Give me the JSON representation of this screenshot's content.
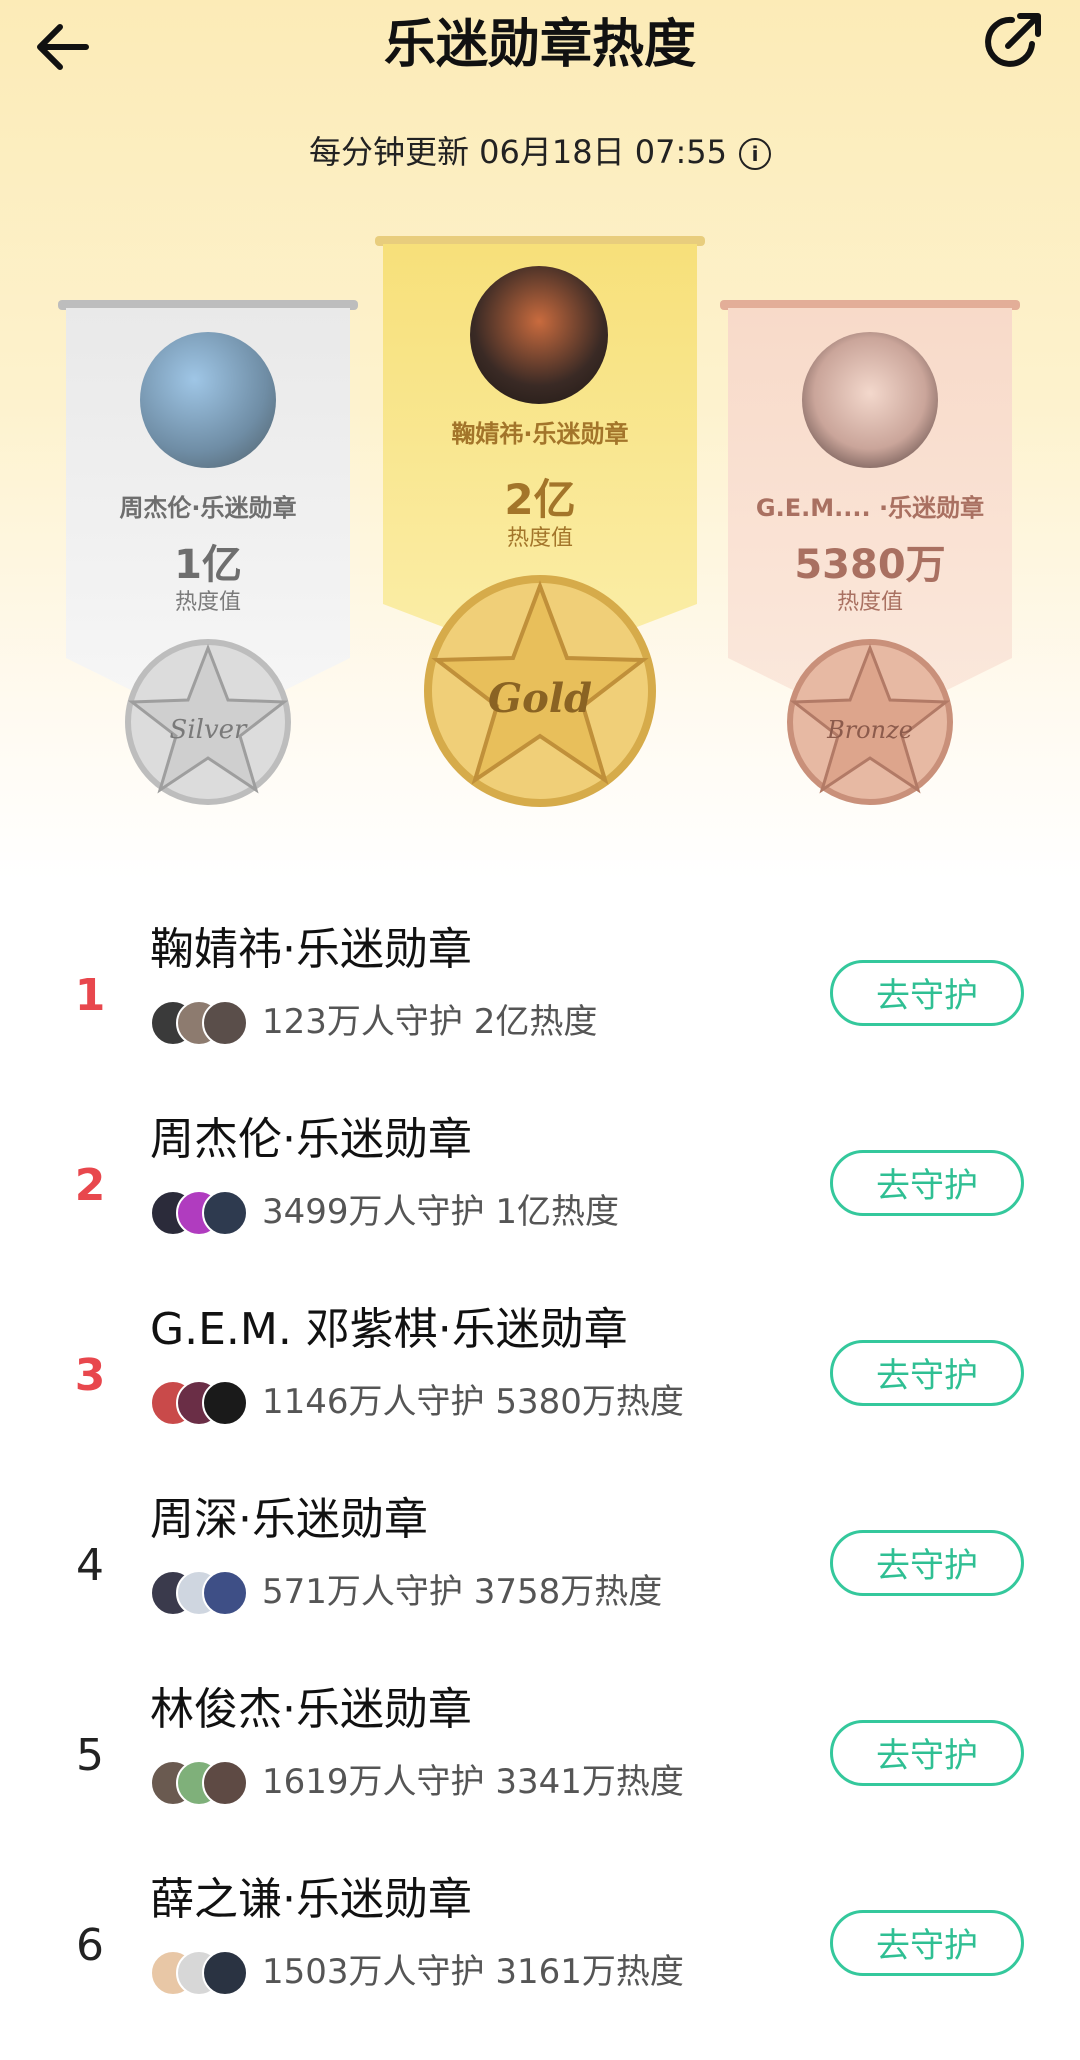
{
  "header": {
    "title": "乐迷勋章热度",
    "update_text": "每分钟更新 06月18日 07:55",
    "back_icon": "arrow-left-icon",
    "share_icon": "share-icon"
  },
  "podium": {
    "silver": {
      "name": "周杰伦·乐迷勋章",
      "value": "1亿",
      "unit": "热度值",
      "medal_text": "Silver",
      "color": "#c9c9c9"
    },
    "gold": {
      "name": "鞠婧祎·乐迷勋章",
      "value": "2亿",
      "unit": "热度值",
      "medal_text": "Gold",
      "color": "#f2cd63"
    },
    "bronze": {
      "name": "G.E.M.... ·乐迷勋章",
      "value": "5380万",
      "unit": "热度值",
      "medal_text": "Bronze",
      "color": "#e8b49b"
    }
  },
  "list": [
    {
      "rank": "1",
      "name": "鞠婧祎·乐迷勋章",
      "meta": "123万人守护 2亿热度",
      "button": "去守护"
    },
    {
      "rank": "2",
      "name": "周杰伦·乐迷勋章",
      "meta": "3499万人守护 1亿热度",
      "button": "去守护"
    },
    {
      "rank": "3",
      "name": "G.E.M. 邓紫棋·乐迷勋章",
      "meta": "1146万人守护 5380万热度",
      "button": "去守护"
    },
    {
      "rank": "4",
      "name": "周深·乐迷勋章",
      "meta": "571万人守护 3758万热度",
      "button": "去守护"
    },
    {
      "rank": "5",
      "name": "林俊杰·乐迷勋章",
      "meta": "1619万人守护 3341万热度",
      "button": "去守护"
    },
    {
      "rank": "6",
      "name": "薛之谦·乐迷勋章",
      "meta": "1503万人守护 3161万热度",
      "button": "去守护"
    }
  ],
  "colors": {
    "accent_green": "#34c89c",
    "top_rank_red": "#e8474d"
  }
}
